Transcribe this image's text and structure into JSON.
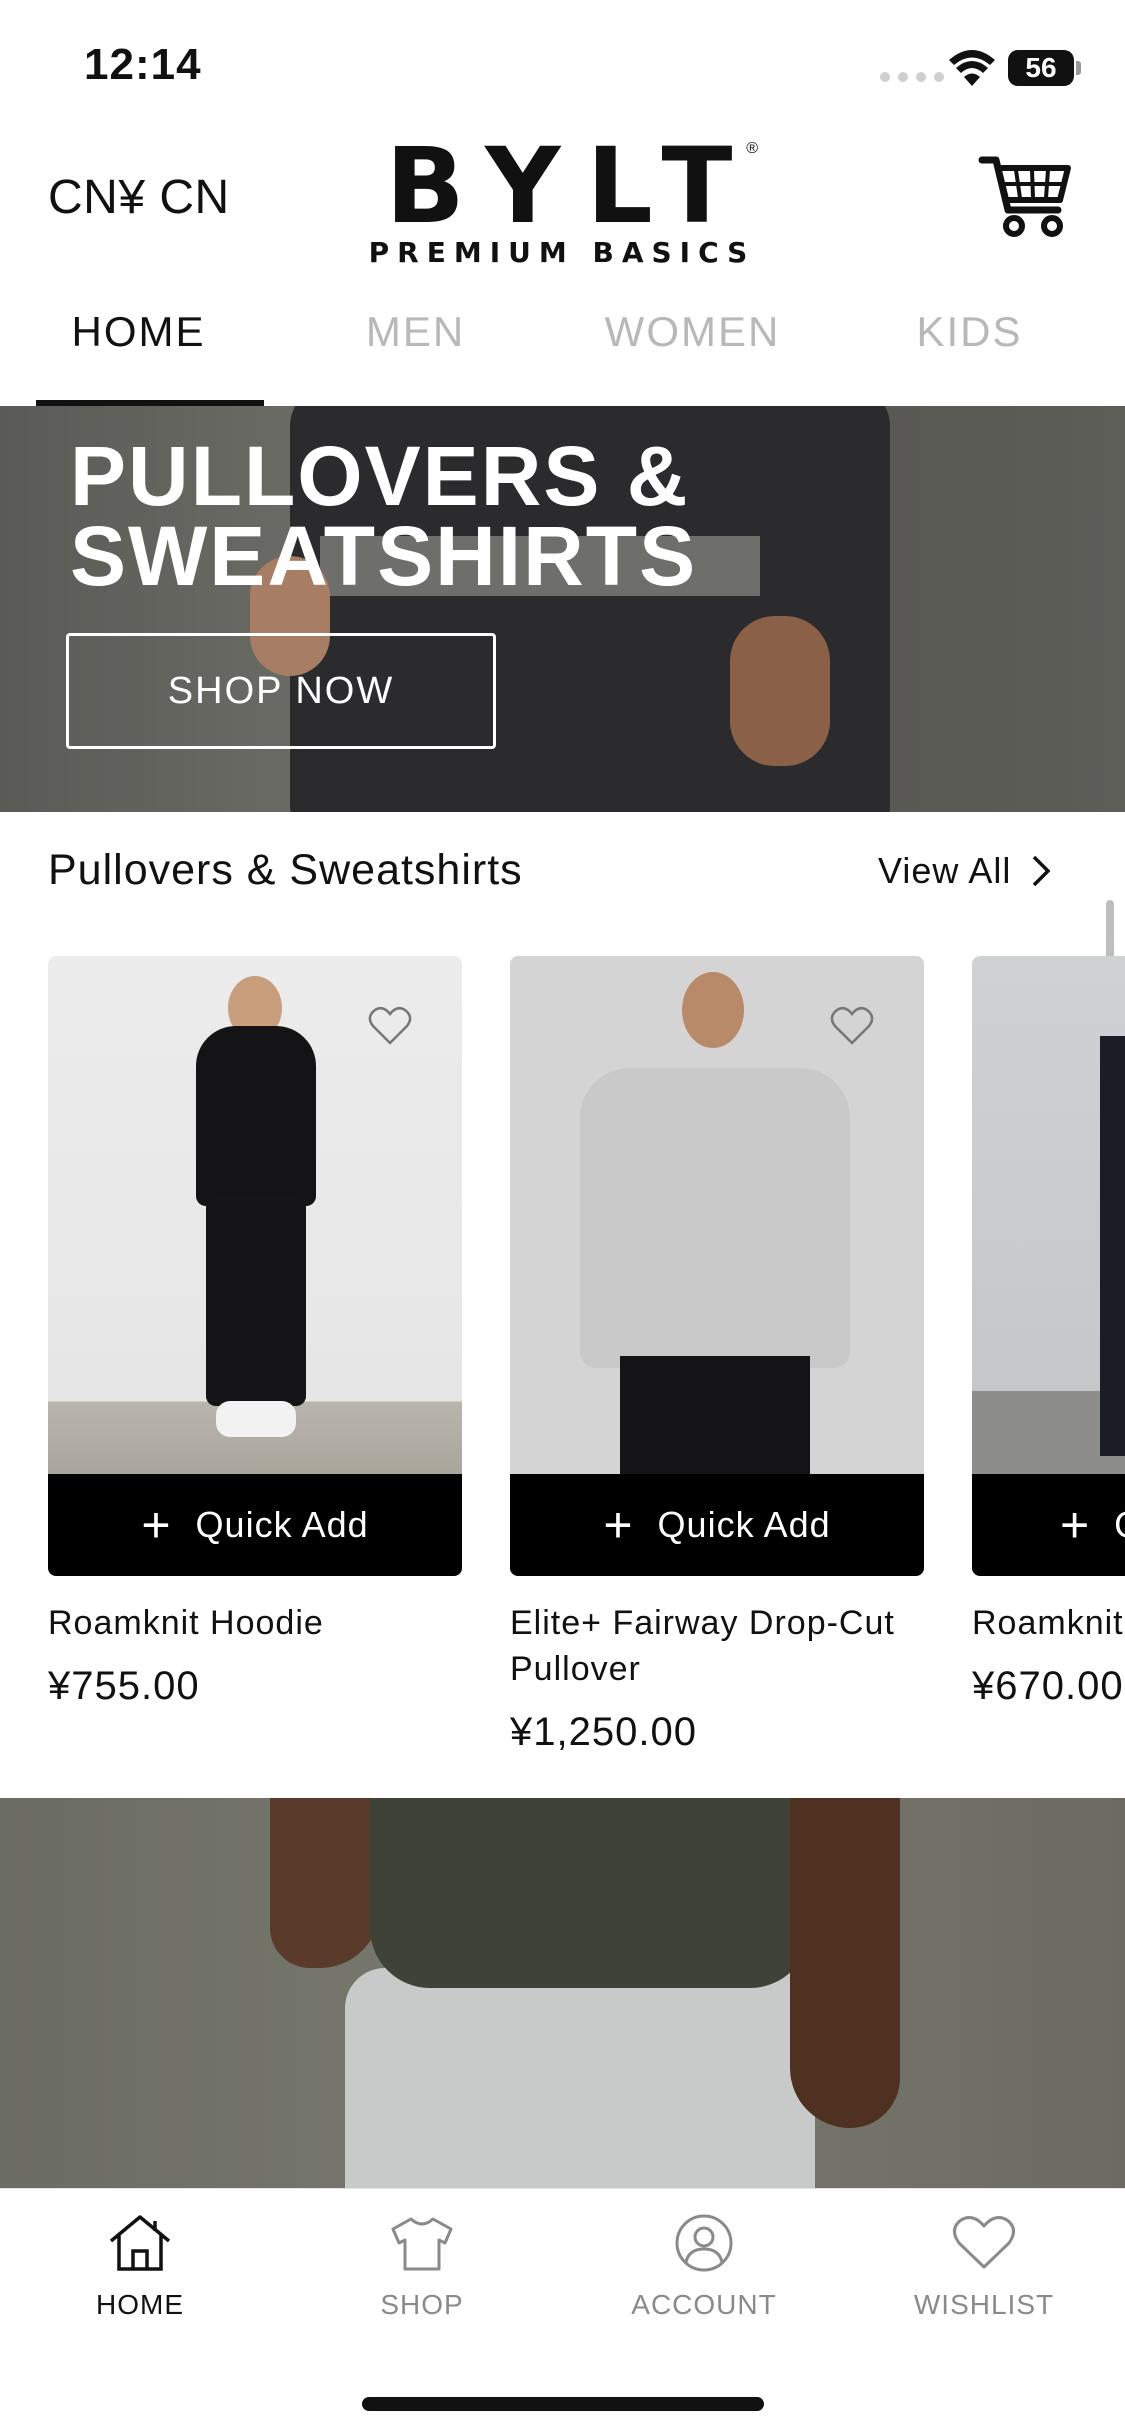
{
  "status_bar": {
    "time": "12:14",
    "battery": "56"
  },
  "header": {
    "currency": "CN¥ CN",
    "logo_word": "BYLT",
    "logo_sub": "PREMIUM BASICS",
    "logo_reg": "®"
  },
  "tabs": [
    {
      "label": "HOME",
      "active": true
    },
    {
      "label": "MEN",
      "active": false
    },
    {
      "label": "WOMEN",
      "active": false
    },
    {
      "label": "KIDS",
      "active": false
    }
  ],
  "hero": {
    "title_line1": "PULLOVERS &",
    "title_line2": "SWEATSHIRTS",
    "button": "SHOP NOW"
  },
  "section": {
    "title": "Pullovers & Sweatshirts",
    "view_all": "View All"
  },
  "products": [
    {
      "name": "Roamknit Hoodie",
      "price": "¥755.00",
      "quick_add": "Quick Add"
    },
    {
      "name": "Elite+ Fairway Drop-Cut Pullover",
      "price": "¥1,250.00",
      "quick_add": "Quick Add"
    },
    {
      "name": "Roamknit",
      "price": "¥670.00",
      "quick_add": "Quick Add"
    }
  ],
  "bottom_nav": [
    {
      "label": "HOME",
      "icon": "home-icon",
      "active": true
    },
    {
      "label": "SHOP",
      "icon": "shirt-icon",
      "active": false
    },
    {
      "label": "ACCOUNT",
      "icon": "account-icon",
      "active": false
    },
    {
      "label": "WISHLIST",
      "icon": "heart-icon",
      "active": false
    }
  ]
}
